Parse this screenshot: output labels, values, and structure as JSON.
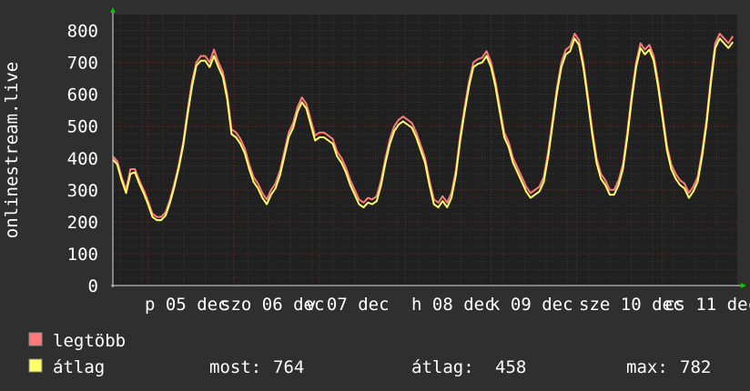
{
  "chart_data": {
    "type": "line",
    "ylabel": "onlinestream.live",
    "ylim": [
      0,
      850
    ],
    "y_ticks": [
      0,
      100,
      200,
      300,
      400,
      500,
      600,
      700,
      800
    ],
    "x_tick_labels": [
      "p 05 dec",
      "szo 06 dec",
      "v 07 dec",
      "h 08 dec",
      "k 09 dec",
      "sze 10 dec",
      "cs 11 dec"
    ],
    "grid": true,
    "colors": {
      "background": "#2f2f2f",
      "plot_area": "#202020",
      "legtobb": "#ff7a7a",
      "atlag": "#ffff66",
      "grid_minor": "#3a3a3a",
      "grid_major": "#7a2a2a",
      "axis_arrow": "#00cc00"
    },
    "series": [
      {
        "name": "legtöbb",
        "points": [
          [
            0,
            405
          ],
          [
            3,
            390
          ],
          [
            6,
            340
          ],
          [
            9,
            300
          ],
          [
            12,
            365
          ],
          [
            15,
            365
          ],
          [
            18,
            330
          ],
          [
            21,
            300
          ],
          [
            24,
            265
          ],
          [
            27,
            225
          ],
          [
            30,
            215
          ],
          [
            33,
            215
          ],
          [
            36,
            230
          ],
          [
            39,
            270
          ],
          [
            42,
            320
          ],
          [
            45,
            380
          ],
          [
            48,
            450
          ],
          [
            51,
            550
          ],
          [
            54,
            640
          ],
          [
            57,
            700
          ],
          [
            60,
            720
          ],
          [
            63,
            720
          ],
          [
            66,
            700
          ],
          [
            69,
            740
          ],
          [
            72,
            700
          ],
          [
            75,
            670
          ],
          [
            78,
            600
          ],
          [
            81,
            490
          ],
          [
            84,
            480
          ],
          [
            87,
            460
          ],
          [
            90,
            430
          ],
          [
            93,
            380
          ],
          [
            96,
            340
          ],
          [
            99,
            320
          ],
          [
            102,
            290
          ],
          [
            105,
            270
          ],
          [
            108,
            300
          ],
          [
            111,
            320
          ],
          [
            114,
            360
          ],
          [
            117,
            420
          ],
          [
            120,
            480
          ],
          [
            123,
            510
          ],
          [
            126,
            560
          ],
          [
            129,
            590
          ],
          [
            132,
            570
          ],
          [
            135,
            520
          ],
          [
            138,
            470
          ],
          [
            141,
            480
          ],
          [
            144,
            480
          ],
          [
            147,
            470
          ],
          [
            150,
            460
          ],
          [
            153,
            420
          ],
          [
            156,
            400
          ],
          [
            159,
            370
          ],
          [
            162,
            330
          ],
          [
            165,
            300
          ],
          [
            168,
            270
          ],
          [
            171,
            260
          ],
          [
            174,
            275
          ],
          [
            177,
            270
          ],
          [
            180,
            280
          ],
          [
            183,
            330
          ],
          [
            186,
            400
          ],
          [
            189,
            460
          ],
          [
            192,
            500
          ],
          [
            195,
            520
          ],
          [
            198,
            530
          ],
          [
            201,
            520
          ],
          [
            204,
            510
          ],
          [
            207,
            480
          ],
          [
            210,
            440
          ],
          [
            213,
            400
          ],
          [
            216,
            330
          ],
          [
            219,
            270
          ],
          [
            222,
            260
          ],
          [
            225,
            280
          ],
          [
            228,
            260
          ],
          [
            231,
            290
          ],
          [
            234,
            360
          ],
          [
            237,
            470
          ],
          [
            240,
            560
          ],
          [
            243,
            640
          ],
          [
            246,
            700
          ],
          [
            249,
            710
          ],
          [
            252,
            715
          ],
          [
            255,
            735
          ],
          [
            258,
            700
          ],
          [
            261,
            640
          ],
          [
            264,
            560
          ],
          [
            267,
            480
          ],
          [
            270,
            450
          ],
          [
            273,
            400
          ],
          [
            276,
            370
          ],
          [
            279,
            340
          ],
          [
            282,
            310
          ],
          [
            285,
            290
          ],
          [
            288,
            300
          ],
          [
            291,
            310
          ],
          [
            294,
            340
          ],
          [
            297,
            420
          ],
          [
            300,
            520
          ],
          [
            303,
            620
          ],
          [
            306,
            700
          ],
          [
            309,
            740
          ],
          [
            312,
            750
          ],
          [
            315,
            790
          ],
          [
            318,
            770
          ],
          [
            321,
            700
          ],
          [
            324,
            600
          ],
          [
            327,
            490
          ],
          [
            330,
            400
          ],
          [
            333,
            350
          ],
          [
            336,
            330
          ],
          [
            339,
            300
          ],
          [
            342,
            300
          ],
          [
            345,
            330
          ],
          [
            348,
            380
          ],
          [
            351,
            480
          ],
          [
            354,
            600
          ],
          [
            357,
            700
          ],
          [
            360,
            760
          ],
          [
            363,
            740
          ],
          [
            366,
            755
          ],
          [
            369,
            720
          ],
          [
            372,
            640
          ],
          [
            375,
            540
          ],
          [
            378,
            440
          ],
          [
            381,
            380
          ],
          [
            384,
            350
          ],
          [
            387,
            330
          ],
          [
            390,
            320
          ],
          [
            393,
            290
          ],
          [
            396,
            310
          ],
          [
            399,
            340
          ],
          [
            402,
            420
          ],
          [
            405,
            520
          ],
          [
            408,
            650
          ],
          [
            411,
            760
          ],
          [
            414,
            790
          ],
          [
            417,
            775
          ],
          [
            420,
            760
          ],
          [
            423,
            782
          ]
        ]
      },
      {
        "name": "átlag",
        "points": [
          [
            0,
            395
          ],
          [
            3,
            380
          ],
          [
            6,
            330
          ],
          [
            9,
            290
          ],
          [
            12,
            350
          ],
          [
            15,
            355
          ],
          [
            18,
            320
          ],
          [
            21,
            290
          ],
          [
            24,
            255
          ],
          [
            27,
            215
          ],
          [
            30,
            205
          ],
          [
            33,
            205
          ],
          [
            36,
            220
          ],
          [
            39,
            260
          ],
          [
            42,
            310
          ],
          [
            45,
            370
          ],
          [
            48,
            440
          ],
          [
            51,
            535
          ],
          [
            54,
            625
          ],
          [
            57,
            690
          ],
          [
            60,
            705
          ],
          [
            63,
            705
          ],
          [
            66,
            685
          ],
          [
            69,
            720
          ],
          [
            72,
            685
          ],
          [
            75,
            655
          ],
          [
            78,
            585
          ],
          [
            81,
            475
          ],
          [
            84,
            465
          ],
          [
            87,
            445
          ],
          [
            90,
            415
          ],
          [
            93,
            365
          ],
          [
            96,
            325
          ],
          [
            99,
            305
          ],
          [
            102,
            275
          ],
          [
            105,
            255
          ],
          [
            108,
            285
          ],
          [
            111,
            305
          ],
          [
            114,
            345
          ],
          [
            117,
            405
          ],
          [
            120,
            465
          ],
          [
            123,
            495
          ],
          [
            126,
            545
          ],
          [
            129,
            575
          ],
          [
            132,
            555
          ],
          [
            135,
            505
          ],
          [
            138,
            455
          ],
          [
            141,
            465
          ],
          [
            144,
            465
          ],
          [
            147,
            455
          ],
          [
            150,
            445
          ],
          [
            153,
            405
          ],
          [
            156,
            385
          ],
          [
            159,
            355
          ],
          [
            162,
            315
          ],
          [
            165,
            285
          ],
          [
            168,
            255
          ],
          [
            171,
            245
          ],
          [
            174,
            260
          ],
          [
            177,
            255
          ],
          [
            180,
            265
          ],
          [
            183,
            315
          ],
          [
            186,
            385
          ],
          [
            189,
            445
          ],
          [
            192,
            485
          ],
          [
            195,
            505
          ],
          [
            198,
            515
          ],
          [
            201,
            505
          ],
          [
            204,
            495
          ],
          [
            207,
            465
          ],
          [
            210,
            425
          ],
          [
            213,
            385
          ],
          [
            216,
            315
          ],
          [
            219,
            255
          ],
          [
            222,
            245
          ],
          [
            225,
            265
          ],
          [
            228,
            245
          ],
          [
            231,
            275
          ],
          [
            234,
            345
          ],
          [
            237,
            455
          ],
          [
            240,
            545
          ],
          [
            243,
            625
          ],
          [
            246,
            685
          ],
          [
            249,
            695
          ],
          [
            252,
            700
          ],
          [
            255,
            720
          ],
          [
            258,
            685
          ],
          [
            261,
            625
          ],
          [
            264,
            545
          ],
          [
            267,
            465
          ],
          [
            270,
            435
          ],
          [
            273,
            385
          ],
          [
            276,
            355
          ],
          [
            279,
            325
          ],
          [
            282,
            295
          ],
          [
            285,
            275
          ],
          [
            288,
            285
          ],
          [
            291,
            295
          ],
          [
            294,
            325
          ],
          [
            297,
            405
          ],
          [
            300,
            505
          ],
          [
            303,
            605
          ],
          [
            306,
            685
          ],
          [
            309,
            725
          ],
          [
            312,
            735
          ],
          [
            315,
            775
          ],
          [
            318,
            755
          ],
          [
            321,
            685
          ],
          [
            324,
            585
          ],
          [
            327,
            475
          ],
          [
            330,
            385
          ],
          [
            333,
            335
          ],
          [
            336,
            315
          ],
          [
            339,
            285
          ],
          [
            342,
            285
          ],
          [
            345,
            315
          ],
          [
            348,
            365
          ],
          [
            351,
            465
          ],
          [
            354,
            585
          ],
          [
            357,
            685
          ],
          [
            360,
            745
          ],
          [
            363,
            725
          ],
          [
            366,
            740
          ],
          [
            369,
            705
          ],
          [
            372,
            625
          ],
          [
            375,
            525
          ],
          [
            378,
            425
          ],
          [
            381,
            365
          ],
          [
            384,
            335
          ],
          [
            387,
            315
          ],
          [
            390,
            305
          ],
          [
            393,
            275
          ],
          [
            396,
            295
          ],
          [
            399,
            325
          ],
          [
            402,
            405
          ],
          [
            405,
            505
          ],
          [
            408,
            635
          ],
          [
            411,
            745
          ],
          [
            414,
            775
          ],
          [
            417,
            760
          ],
          [
            420,
            745
          ],
          [
            423,
            764
          ]
        ]
      }
    ],
    "legend": [
      {
        "name": "legtöbb",
        "color": "#ff7a7a"
      },
      {
        "name": "átlag",
        "color": "#ffff66"
      }
    ],
    "stats": {
      "most_label": "most:",
      "most_value": "764",
      "atlag_label": "átlag:",
      "atlag_value": "458",
      "max_label": "max:",
      "max_value": "782"
    }
  }
}
